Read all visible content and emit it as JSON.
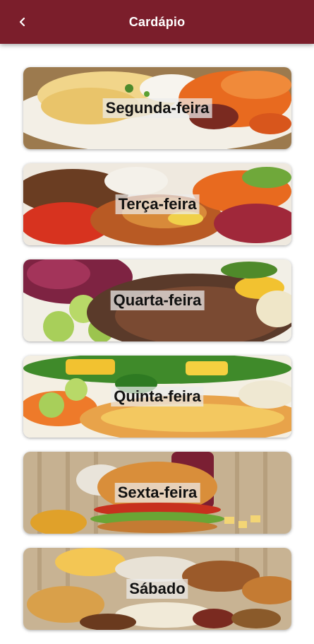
{
  "header": {
    "title": "Cardápio",
    "back_icon": "chevron-left-icon",
    "background_color": "#7b1e2b"
  },
  "menu": {
    "days": [
      {
        "label": "Segunda-feira",
        "image": "omelet-plate-image"
      },
      {
        "label": "Terça-feira",
        "image": "grilled-chicken-plate-image"
      },
      {
        "label": "Quarta-feira",
        "image": "steak-plate-image"
      },
      {
        "label": "Quinta-feira",
        "image": "quiche-vegetables-image"
      },
      {
        "label": "Sexta-feira",
        "image": "burger-image"
      },
      {
        "label": "Sábado",
        "image": "bakery-table-image"
      }
    ]
  }
}
